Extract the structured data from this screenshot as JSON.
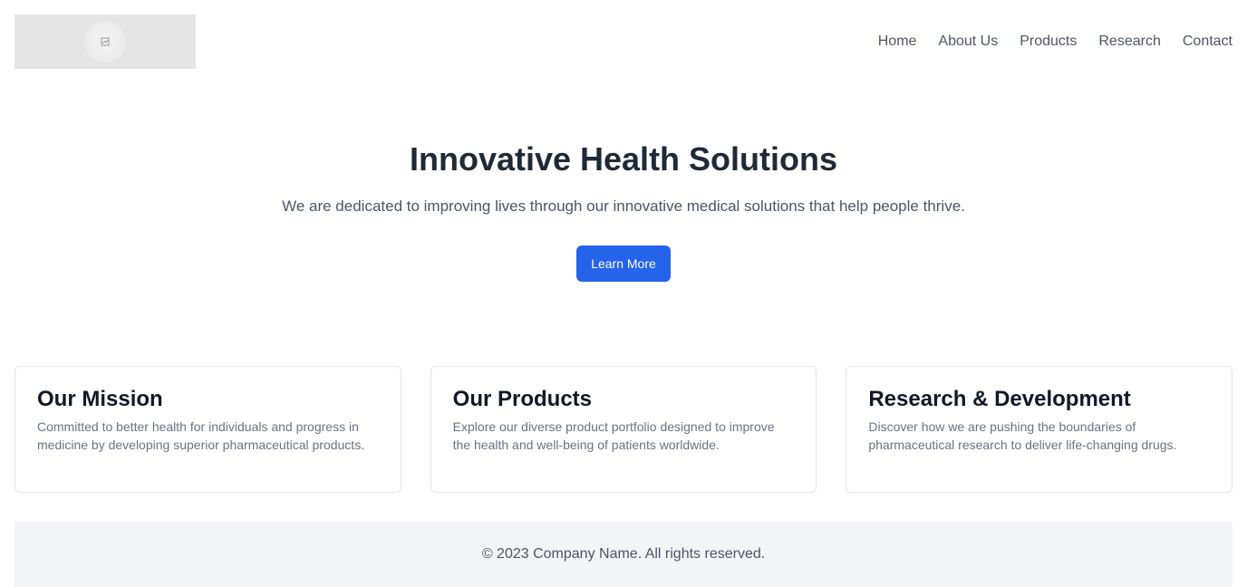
{
  "header": {
    "logo_icon": "broken-image-icon",
    "nav": [
      {
        "label": "Home"
      },
      {
        "label": "About Us"
      },
      {
        "label": "Products"
      },
      {
        "label": "Research"
      },
      {
        "label": "Contact"
      }
    ]
  },
  "hero": {
    "title": "Innovative Health Solutions",
    "subtitle": "We are dedicated to improving lives through our innovative medical solutions that help people thrive.",
    "button_label": "Learn More"
  },
  "cards": [
    {
      "title": "Our Mission",
      "text": "Committed to better health for individuals and progress in medicine by developing superior pharmaceutical products."
    },
    {
      "title": "Our Products",
      "text": "Explore our diverse product portfolio designed to improve the health and well-being of patients worldwide."
    },
    {
      "title": "Research & Development",
      "text": "Discover how we are pushing the boundaries of pharmaceutical research to deliver life-changing drugs."
    }
  ],
  "footer": {
    "text": "© 2023 Company Name. All rights reserved."
  },
  "colors": {
    "accent": "#2563eb",
    "heading": "#1f2937",
    "body_text": "#4b5563",
    "muted_text": "#6b7280",
    "footer_bg": "#f3f4f6"
  }
}
